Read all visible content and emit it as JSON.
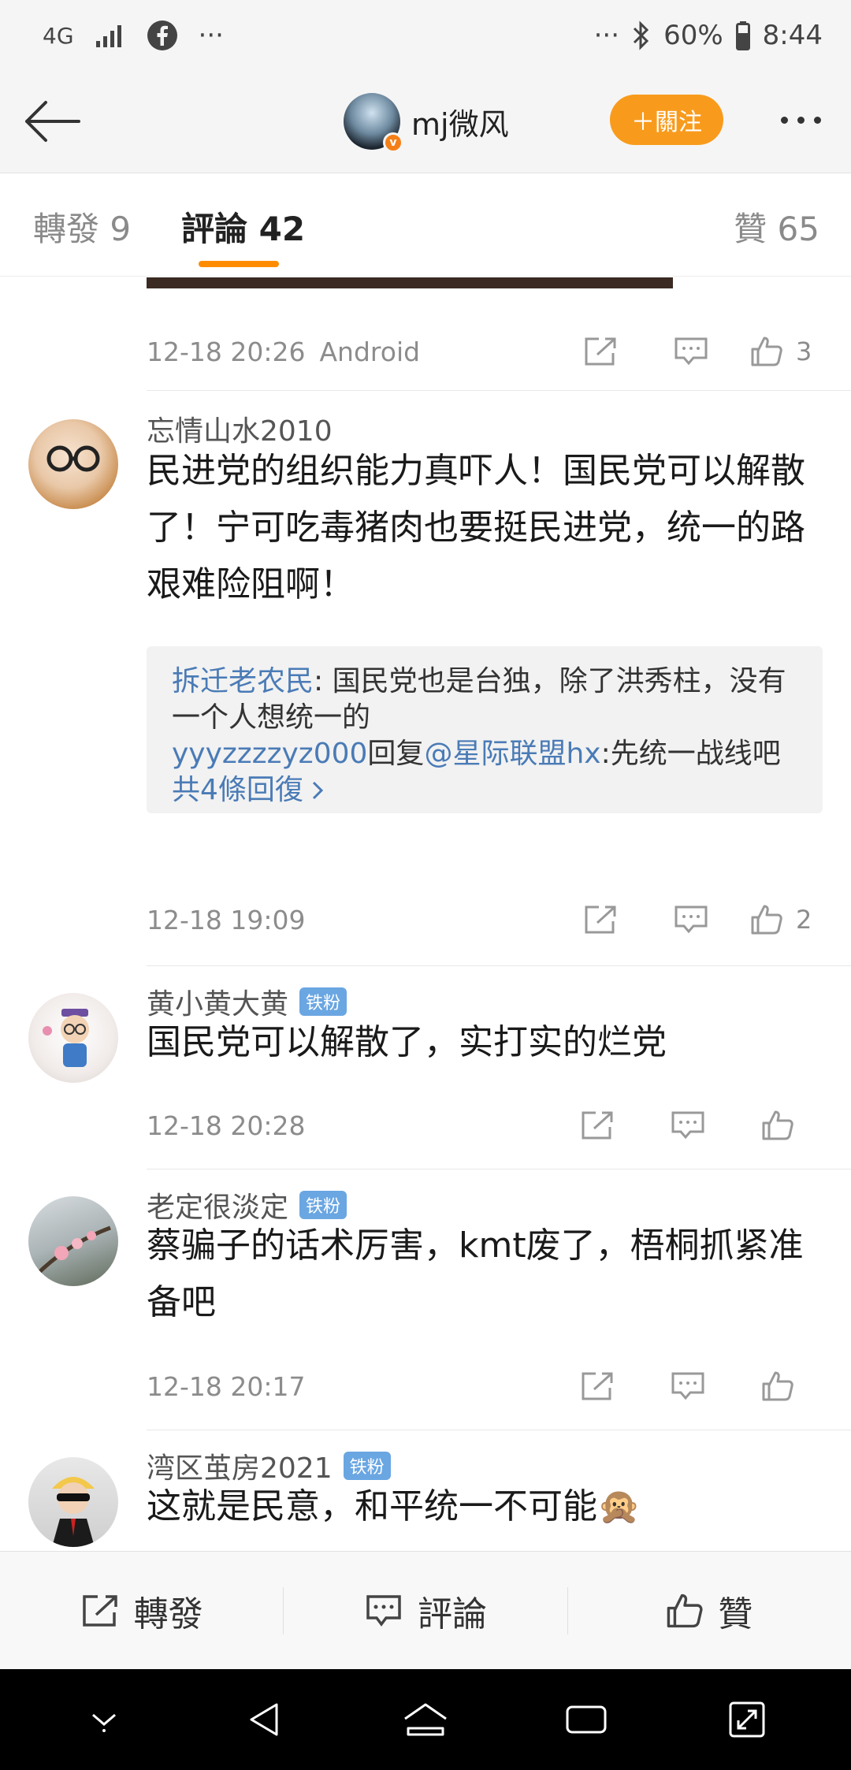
{
  "status_bar": {
    "network": "4G",
    "left_dots": "···",
    "right_dots": "···",
    "battery": "60%",
    "time": "8:44"
  },
  "header": {
    "author_name": "mj微风",
    "follow_label": "＋關注"
  },
  "tabs": {
    "repost": "轉發 9",
    "comments": "評論 42",
    "likes": "贊 65"
  },
  "post_meta": {
    "time": "12-18 20:26",
    "source": "Android",
    "like_count": "3"
  },
  "comments": [
    {
      "name": "忘情山水2010",
      "text": "民进党的组织能力真吓人！国民党可以解散了！宁可吃毒猪肉也要挺民进党，统一的路艰难险阻啊！",
      "replies": {
        "r1_name": "拆迁老农民",
        "r1_text": ": 国民党也是台独，除了洪秀柱，没有一个人想统一的",
        "r2_name": "yyyzzzzyz000",
        "r2_mid": "回复",
        "r2_mention": "@星际联盟hx",
        "r2_text": ":先统一战线吧",
        "more": "共4條回復"
      },
      "time": "12-18 19:09",
      "like_count": "2"
    },
    {
      "name": "黄小黄大黄",
      "badge": "铁粉",
      "text": "国民党可以解散了，实打实的烂党",
      "time": "12-18 20:28"
    },
    {
      "name": "老定很淡定",
      "badge": "铁粉",
      "text": "蔡骗子的话术厉害，kmt废了，梧桐抓紧准备吧",
      "time": "12-18 20:17"
    },
    {
      "name": "湾区茧房2021",
      "badge": "铁粉",
      "text": "这就是民意，和平统一不可能🙊"
    }
  ],
  "bottom_bar": {
    "repost": "轉發",
    "comment": "評論",
    "like": "贊"
  }
}
